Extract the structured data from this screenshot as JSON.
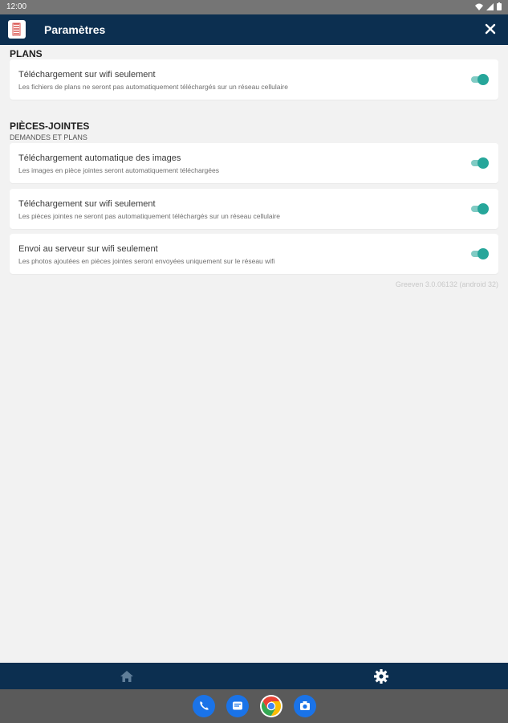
{
  "status_bar": {
    "time": "12:00"
  },
  "app_bar": {
    "title": "Paramètres"
  },
  "sections": {
    "plans": {
      "title": "PLANS",
      "items": [
        {
          "title": "Téléchargement sur wifi seulement",
          "description": "Les fichiers de plans ne seront pas automatiquement téléchargés sur un réseau cellulaire",
          "enabled": true
        }
      ]
    },
    "attachments": {
      "title": "PIÈCES-JOINTES",
      "subtitle": "DEMANDES ET PLANS",
      "items": [
        {
          "title": "Téléchargement automatique des images",
          "description": "Les images en pièce jointes seront automatiquement téléchargées",
          "enabled": true
        },
        {
          "title": "Téléchargement sur wifi seulement",
          "description": "Les pièces jointes ne seront pas automatiquement téléchargés sur un réseau cellulaire",
          "enabled": true
        },
        {
          "title": "Envoi au serveur sur wifi seulement",
          "description": "Les photos ajoutées en pièces jointes seront envoyées uniquement sur le réseau wifi",
          "enabled": true
        }
      ]
    }
  },
  "version": "Greeven 3.0.06132 (android 32)",
  "bottom_nav": {
    "home_icon": "home-icon",
    "settings_icon": "gear-icon"
  },
  "dock": {
    "apps": [
      "phone",
      "messages",
      "chrome",
      "camera"
    ]
  },
  "colors": {
    "primary": "#0c2f50",
    "toggle": "#26a69a",
    "background": "#f2f2f2"
  }
}
